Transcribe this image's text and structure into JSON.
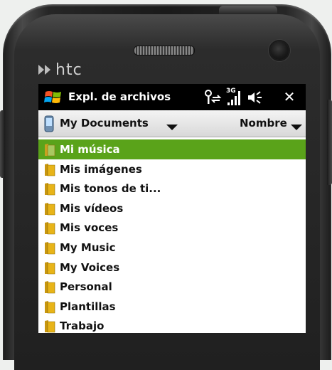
{
  "brand": {
    "logo_text": "htc"
  },
  "titlebar": {
    "title": "Expl. de archivos",
    "network_label": "3G",
    "close_label": "✕"
  },
  "location": {
    "current": "My Documents",
    "sort_label": "Nombre"
  },
  "folders": [
    {
      "name": "Mi música",
      "selected": true
    },
    {
      "name": "Mis imágenes",
      "selected": false
    },
    {
      "name": "Mis tonos de ti...",
      "selected": false
    },
    {
      "name": "Mis vídeos",
      "selected": false
    },
    {
      "name": "Mis voces",
      "selected": false
    },
    {
      "name": "My Music",
      "selected": false
    },
    {
      "name": "My Voices",
      "selected": false
    },
    {
      "name": "Personal",
      "selected": false
    },
    {
      "name": "Plantillas",
      "selected": false
    },
    {
      "name": "Trabajo",
      "selected": false
    }
  ],
  "colors": {
    "selection": "#5aa31a",
    "titlebar": "#000000",
    "folder": "#e8b418"
  }
}
